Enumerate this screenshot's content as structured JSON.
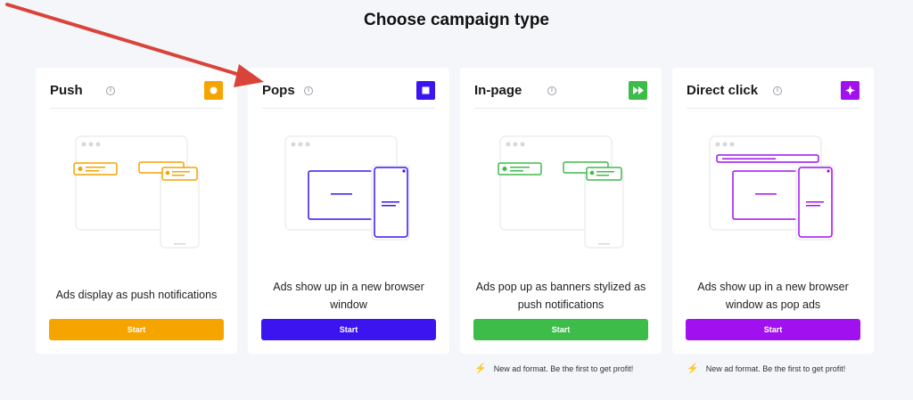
{
  "page": {
    "title": "Choose campaign type"
  },
  "colors": {
    "push": "#f6a400",
    "pops": "#3b14f0",
    "inpage": "#3ebc4a",
    "direct": "#a111f0",
    "arrow": "#d9443a"
  },
  "cards": [
    {
      "name": "Push",
      "icon": "circle-icon",
      "description": "Ads display as push notifications",
      "button": "Start"
    },
    {
      "name": "Pops",
      "icon": "square-icon",
      "description": "Ads show up in a new browser window",
      "button": "Start"
    },
    {
      "name": "In-page",
      "icon": "fast-forward-icon",
      "description": "Ads pop up as banners stylized as push notifications",
      "button": "Start",
      "note": "New ad format. Be the first to get profit!"
    },
    {
      "name": "Direct click",
      "icon": "sparkle-icon",
      "description": "Ads show up in a new browser window as pop ads",
      "button": "Start",
      "note": "New ad format. Be the first to get profit!"
    }
  ]
}
